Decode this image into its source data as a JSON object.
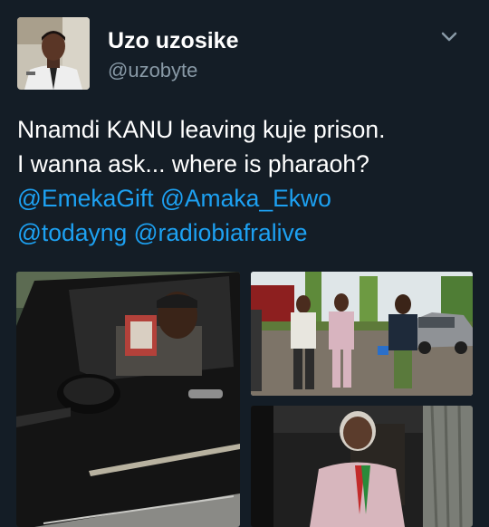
{
  "tweet": {
    "user": {
      "display_name": "Uzo uzosike",
      "handle": "@uzobyte"
    },
    "text": {
      "line1": "Nnamdi KANU leaving kuje prison.",
      "line2": "I wanna ask... where is pharaoh?",
      "mentions": [
        "@EmekaGift",
        "@Amaka_Ekwo",
        "@todayng",
        "@radiobiafralive"
      ]
    },
    "photos": [
      {
        "icon": "car-driver-photo"
      },
      {
        "icon": "prison-yard-walking-photo"
      },
      {
        "icon": "seated-man-portrait-photo"
      }
    ]
  },
  "colors": {
    "background": "#141d26",
    "text": "#ffffff",
    "secondary_text": "#8899a6",
    "link": "#1da1f2"
  },
  "icons": {
    "caret": "chevron-down-icon",
    "avatar": "user-avatar"
  }
}
